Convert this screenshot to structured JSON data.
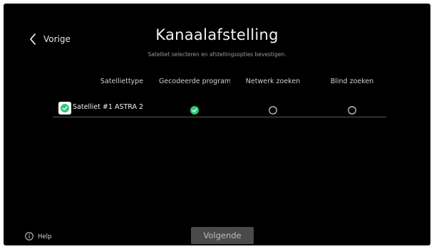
{
  "header": {
    "back_label": "Vorige",
    "title": "Kanaalafstelling",
    "subtitle": "Satelliet selecteren en afstellingsopties bevestigen."
  },
  "table": {
    "columns": [
      "Satelliettype",
      "Gecodeerde programma's",
      "Netwerk zoeken",
      "Blind zoeken"
    ],
    "rows": [
      {
        "selected": true,
        "satellite": "Satelliet #1 ASTRA 2",
        "coded_programs": true,
        "network_search": false,
        "blind_search": false
      }
    ]
  },
  "footer": {
    "help_label": "Help",
    "next_label": "Volgende"
  },
  "colors": {
    "accent_green": "#2ec877",
    "background": "#000000",
    "button_bg": "#4a4a4a"
  },
  "icons": {
    "back": "chevron-left-icon",
    "help": "info-icon",
    "checked": "check-circle-icon",
    "unchecked": "radio-empty-icon"
  }
}
